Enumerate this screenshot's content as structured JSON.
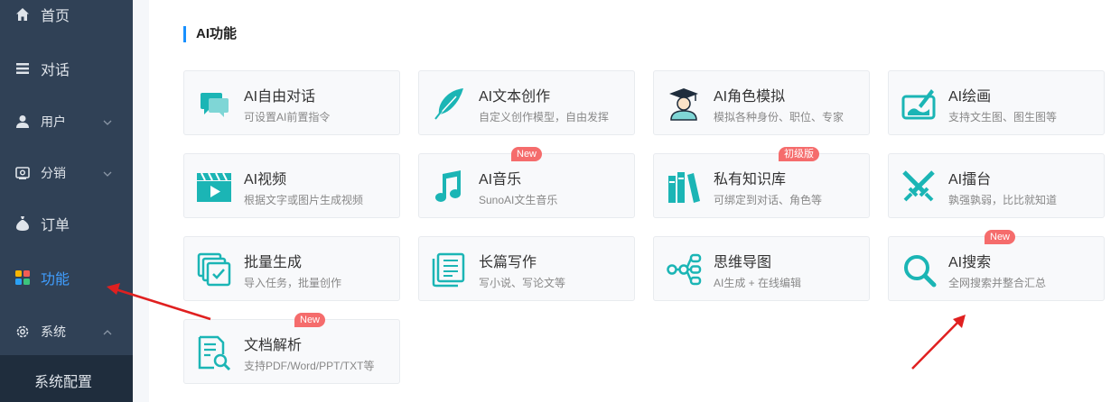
{
  "sidebar": {
    "items": [
      {
        "label": "首页",
        "icon": "home-icon"
      },
      {
        "label": "对话",
        "icon": "list-icon"
      },
      {
        "label": "用户",
        "icon": "user-icon"
      },
      {
        "label": "分销",
        "icon": "distribution-icon"
      },
      {
        "label": "订单",
        "icon": "bag-icon"
      },
      {
        "label": "功能",
        "icon": "grid-icon",
        "active": true
      },
      {
        "label": "系统",
        "icon": "gear-icon"
      }
    ],
    "sub_item": "系统配置"
  },
  "colors": {
    "sidebar_bg": "#304156",
    "active": "#409eff",
    "icon_teal": "#1bb5b5",
    "badge": "#f56c6c",
    "arrow": "#e02020"
  },
  "main": {
    "section_title": "AI功能",
    "cards": [
      {
        "title": "AI自由对话",
        "desc": "可设置AI前置指令",
        "icon": "chat-icon",
        "badge": ""
      },
      {
        "title": "AI文本创作",
        "desc": "自定义创作模型，自由发挥",
        "icon": "feather-icon",
        "badge": ""
      },
      {
        "title": "AI角色模拟",
        "desc": "模拟各种身份、职位、专家",
        "icon": "graduate-icon",
        "badge": ""
      },
      {
        "title": "AI绘画",
        "desc": "支持文生图、图生图等",
        "icon": "paint-icon",
        "badge": ""
      },
      {
        "title": "AI视频",
        "desc": "根据文字或图片生成视频",
        "icon": "video-icon",
        "badge": ""
      },
      {
        "title": "AI音乐",
        "desc": "SunoAI文生音乐",
        "icon": "music-icon",
        "badge": "New"
      },
      {
        "title": "私有知识库",
        "desc": "可绑定到对话、角色等",
        "icon": "books-icon",
        "badge": "初级版"
      },
      {
        "title": "AI擂台",
        "desc": "孰强孰弱，比比就知道",
        "icon": "swords-icon",
        "badge": ""
      },
      {
        "title": "批量生成",
        "desc": "导入任务，批量创作",
        "icon": "batch-icon",
        "badge": ""
      },
      {
        "title": "长篇写作",
        "desc": "写小说、写论文等",
        "icon": "scroll-icon",
        "badge": ""
      },
      {
        "title": "思维导图",
        "desc": "AI生成 + 在线编辑",
        "icon": "mindmap-icon",
        "badge": ""
      },
      {
        "title": "AI搜索",
        "desc": "全网搜索并整合汇总",
        "icon": "search-icon",
        "badge": "New"
      },
      {
        "title": "文档解析",
        "desc": "支持PDF/Word/PPT/TXT等",
        "icon": "doc-search-icon",
        "badge": "New"
      }
    ]
  }
}
